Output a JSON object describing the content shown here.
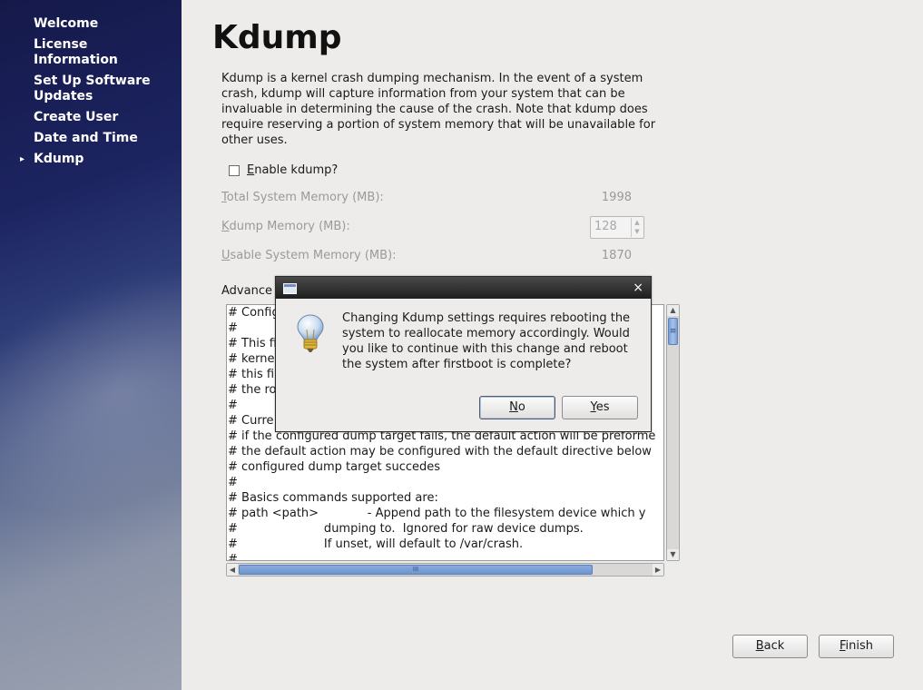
{
  "sidebar": {
    "items": [
      {
        "label": "Welcome"
      },
      {
        "label": "License Information"
      },
      {
        "label": "Set Up Software Updates"
      },
      {
        "label": "Create User"
      },
      {
        "label": "Date and Time"
      },
      {
        "label": "Kdump",
        "active": true,
        "marker": "▸"
      }
    ]
  },
  "main": {
    "title": "Kdump",
    "description": "Kdump is a kernel crash dumping mechanism. In the event of a system crash, kdump will capture information from your system that can be invaluable in determining the cause of the crash. Note that kdump does require reserving a portion of system memory that will be unavailable for other uses.",
    "enable_checkbox": {
      "mnemonic": "E",
      "label_rest": "nable kdump?",
      "checked": false
    },
    "total_memory": {
      "mnemonic": "T",
      "label_rest": "otal System Memory (MB):",
      "value": "1998"
    },
    "kdump_memory": {
      "mnemonic": "K",
      "label_rest": "dump Memory (MB):",
      "value": "128"
    },
    "usable_memory": {
      "mnemonic": "U",
      "label_rest": "sable System Memory (MB):",
      "value": "1870"
    },
    "advanced_label": "Advance",
    "config_text": "# Configu\n#\n# This fil\n# kerne                                                                          Di\n# this fi                                                                        ect\n# the ro                                                                         es.\n#\n# Curre                                                                          e\n# if the configured dump target fails, the default action will be preforme\n# the default action may be configured with the default directive below\n# configured dump target succedes\n#\n# Basics commands supported are:\n# path <path>             - Append path to the filesystem device which y\n#                       dumping to.  Ignored for raw device dumps.\n#                       If unset, will default to /var/crash.\n#"
  },
  "dialog": {
    "close_glyph": "×",
    "icon": "lightbulb-icon",
    "message": "Changing Kdump settings requires rebooting the system to reallocate memory accordingly. Would you like to continue with this change and reboot the system after firstboot is complete?",
    "no": {
      "mnemonic": "N",
      "rest": "o"
    },
    "yes": {
      "mnemonic": "Y",
      "rest": "es"
    }
  },
  "footer": {
    "back": {
      "mnemonic": "B",
      "rest": "ack"
    },
    "finish": {
      "mnemonic": "F",
      "rest": "inish"
    }
  },
  "scroll_glyphs": {
    "up": "▲",
    "down": "▼",
    "left": "◀",
    "right": "▶",
    "grip_v": "≡",
    "grip_h": "III"
  }
}
